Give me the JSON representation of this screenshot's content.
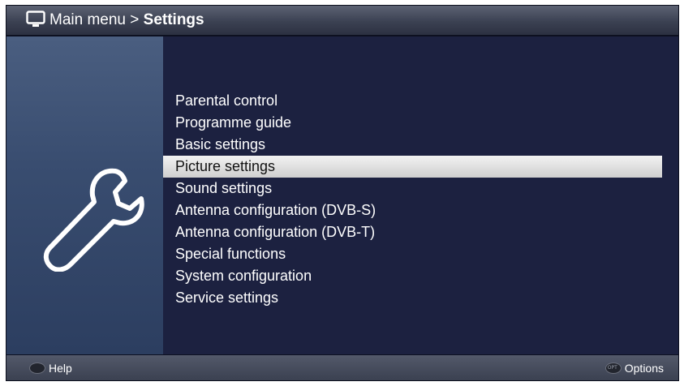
{
  "header": {
    "path_prefix": "Main menu > ",
    "path_current": "Settings"
  },
  "menu": {
    "items": [
      "Parental control",
      "Programme guide",
      "Basic settings",
      "Picture settings",
      "Sound settings",
      "Antenna configuration (DVB-S)",
      "Antenna configuration (DVB-T)",
      "Special functions",
      "System configuration",
      "Service settings"
    ],
    "selected_index": 3
  },
  "footer": {
    "help_label": "Help",
    "options_label": "Options"
  },
  "icons": {
    "title": "tv-icon",
    "panel": "wrench-icon",
    "help_key": "help-key-icon",
    "options_key": "options-key-icon"
  },
  "colors": {
    "background": "#1c2140",
    "panel": "#394d70",
    "highlight": "#e6e6e6"
  }
}
